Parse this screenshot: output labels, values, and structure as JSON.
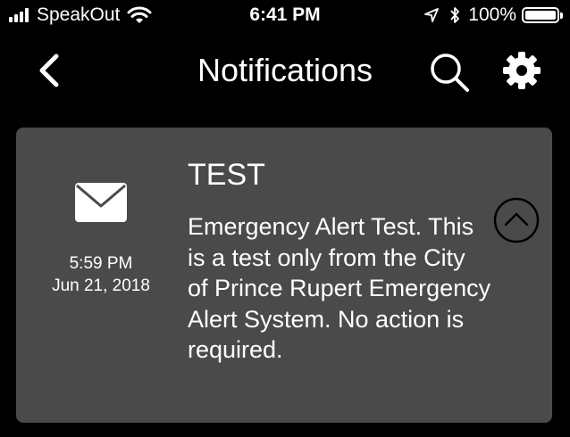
{
  "status_bar": {
    "carrier": "SpeakOut",
    "time": "6:41 PM",
    "battery_percent": "100%",
    "signal_bars": 4,
    "icons": [
      "signal-bars-icon",
      "wifi-icon",
      "location-arrow-icon",
      "bluetooth-icon",
      "battery-icon"
    ]
  },
  "nav": {
    "title": "Notifications",
    "back_icon": "chevron-left-icon",
    "search_icon": "search-icon",
    "settings_icon": "gear-icon"
  },
  "notification": {
    "icon": "envelope-icon",
    "time": "5:59 PM",
    "date": "Jun 21, 2018",
    "title": "TEST",
    "body": "Emergency Alert Test. This is a test only from the City of Prince Rupert Emergency Alert System. No action is required.",
    "toggle_icon": "chevron-up-circle-icon"
  },
  "colors": {
    "background": "#000000",
    "card": "#4a4a4a",
    "text": "#ffffff"
  }
}
